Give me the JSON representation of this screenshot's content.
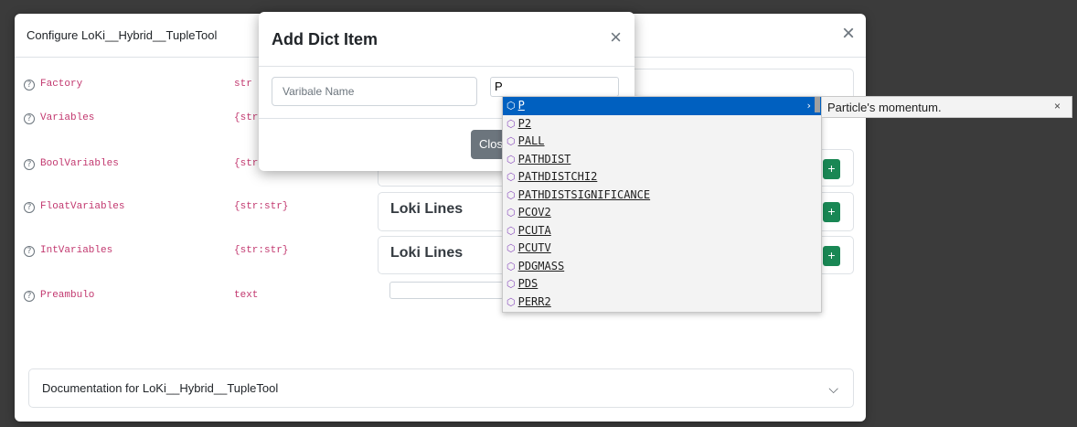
{
  "main_modal": {
    "title": "Configure LoKi__Hybrid__TupleTool",
    "close_symbol": "×",
    "help_symbol": "?",
    "properties": [
      {
        "name": "Factory",
        "type": "str"
      },
      {
        "name": "Variables",
        "type": "{str"
      },
      {
        "name": "BoolVariables",
        "type": "{str"
      },
      {
        "name": "FloatVariables",
        "type": "{str:str}"
      },
      {
        "name": "IntVariables",
        "type": "{str:str}"
      },
      {
        "name": "Preambulo",
        "type": "text"
      }
    ],
    "loki_lines_label": "Loki Lines",
    "add_symbol": "+",
    "documentation_label": "Documentation for LoKi__Hybrid__TupleTool",
    "chevron_symbol": "⌵"
  },
  "dict_dialog": {
    "title": "Add Dict Item",
    "close_symbol": "×",
    "name_placeholder": "Varibale Name",
    "value_text": "P",
    "close_button_label": "Close"
  },
  "autocomplete": {
    "cube_symbol": "⬡",
    "arrow_symbol": "›",
    "items": [
      "P",
      "P2",
      "PALL",
      "PATHDIST",
      "PATHDISTCHI2",
      "PATHDISTSIGNIFICANCE",
      "PCOV2",
      "PCUTA",
      "PCUTV",
      "PDGMASS",
      "PDS",
      "PERR2"
    ],
    "selected_index": 0,
    "detail": "Particle's momentum.",
    "detail_close_symbol": "×"
  }
}
